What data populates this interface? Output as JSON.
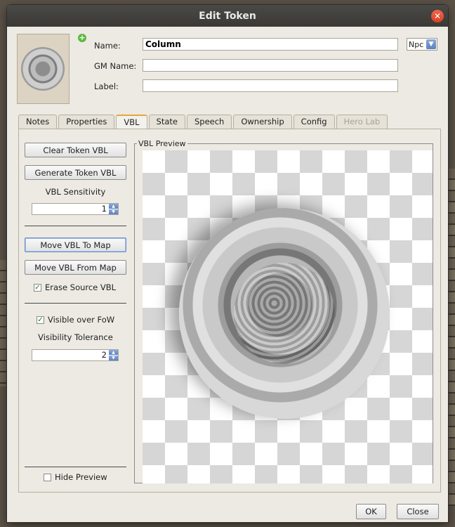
{
  "window": {
    "title": "Edit Token",
    "close_icon": "close-icon"
  },
  "form": {
    "name_label": "Name:",
    "name_value": "Column",
    "type_value": "Npc",
    "gm_name_label": "GM Name:",
    "gm_name_value": "",
    "label_label": "Label:",
    "label_value": ""
  },
  "tabs": [
    {
      "label": "Notes"
    },
    {
      "label": "Properties"
    },
    {
      "label": "VBL"
    },
    {
      "label": "State"
    },
    {
      "label": "Speech"
    },
    {
      "label": "Ownership"
    },
    {
      "label": "Config"
    },
    {
      "label": "Hero Lab"
    }
  ],
  "vbl": {
    "clear_button": "Clear Token VBL",
    "generate_button": "Generate Token VBL",
    "sensitivity_label": "VBL Sensitivity",
    "sensitivity_value": "1",
    "move_to_map_button": "Move VBL To Map",
    "move_from_map_button": "Move VBL From Map",
    "erase_source_label": "Erase Source VBL",
    "erase_source_checked": true,
    "visible_fow_label": "Visible over FoW",
    "visible_fow_checked": true,
    "tolerance_label": "Visibility Tolerance",
    "tolerance_value": "2",
    "hide_preview_label": "Hide Preview",
    "hide_preview_checked": false,
    "preview_title": "VBL Preview"
  },
  "footer": {
    "ok_button": "OK",
    "close_button": "Close"
  },
  "colors": {
    "active_tab_accent": "#e3a83a",
    "title_bar": "#3c3b38",
    "close_button": "#e1502f"
  }
}
